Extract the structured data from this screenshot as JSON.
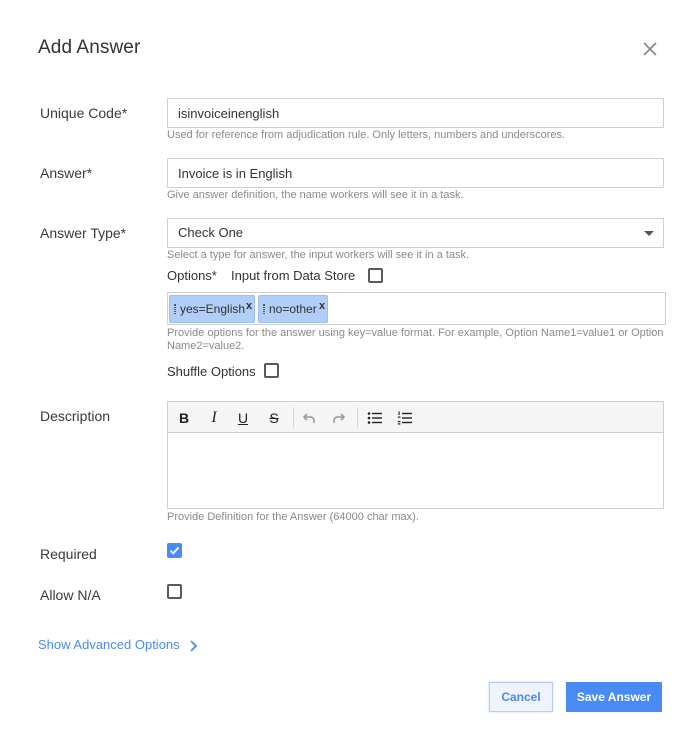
{
  "dialog": {
    "title": "Add Answer",
    "close_icon": "close-icon"
  },
  "unique_code": {
    "label": "Unique Code*",
    "value": "isinvoiceinenglish",
    "hint": "Used for reference from adjudication rule. Only letters, numbers and underscores."
  },
  "answer": {
    "label": "Answer*",
    "value": "Invoice is in English",
    "hint": "Give answer definition, the name workers will see it in a task."
  },
  "answer_type": {
    "label": "Answer Type*",
    "value": "Check One",
    "hint": "Select a type for answer, the input workers will see it in a task."
  },
  "options": {
    "label": "Options*",
    "data_store_label": "Input from Data Store",
    "data_store_checked": false,
    "tags": [
      {
        "text": "yes=English",
        "remove": "x"
      },
      {
        "text": "no=other",
        "remove": "x"
      }
    ],
    "hint_line1": "Provide options for the answer using key=value format. For example, Option Name1=value1 or Option",
    "hint_line2": "Name2=value2.",
    "shuffle_label": "Shuffle Options",
    "shuffle_checked": false
  },
  "description": {
    "label": "Description",
    "toolbar": {
      "bold": "B",
      "italic": "I",
      "underline": "U",
      "strike": "S"
    },
    "hint": "Provide Definition for the Answer (64000 char max)."
  },
  "required": {
    "label": "Required",
    "checked": true
  },
  "allow_na": {
    "label": "Allow N/A",
    "checked": false
  },
  "advanced": {
    "label": "Show Advanced Options"
  },
  "footer": {
    "cancel_label": "Cancel",
    "save_label": "Save Answer"
  },
  "colors": {
    "accent": "#4a8af4",
    "tag_bg": "#b0cef6"
  }
}
